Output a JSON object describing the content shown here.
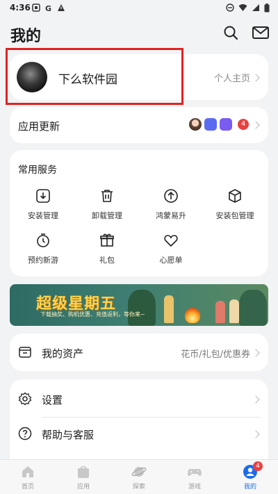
{
  "status_bar": {
    "time": "4:36",
    "icons": [
      "battery-saver-icon",
      "google-g-icon",
      "warning-icon",
      "dnd-icon",
      "wifi-icon",
      "signal-icon",
      "battery-icon"
    ]
  },
  "header": {
    "title": "我的"
  },
  "profile": {
    "name": "下么软件园",
    "home_link": "个人主页"
  },
  "app_update": {
    "label": "应用更新",
    "badge_count": "4"
  },
  "services": {
    "heading": "常用服务",
    "items": [
      {
        "label": "安装管理",
        "icon": "download-box-icon"
      },
      {
        "label": "卸载管理",
        "icon": "trash-icon"
      },
      {
        "label": "鸿蒙易升",
        "icon": "arrow-up-circle-icon"
      },
      {
        "label": "安装包管理",
        "icon": "package-icon"
      },
      {
        "label": "预约新游",
        "icon": "alarm-icon"
      },
      {
        "label": "礼包",
        "icon": "gift-icon"
      },
      {
        "label": "心愿单",
        "icon": "heart-icon"
      }
    ]
  },
  "banner": {
    "title": "超级星期五",
    "subtitle": "下载抽奖、购机优惠、充值返利，等你来~"
  },
  "assets": {
    "label": "我的资产",
    "detail": "花币/礼包/优惠券"
  },
  "settings": {
    "items": [
      {
        "label": "设置"
      },
      {
        "label": "帮助与客服"
      }
    ]
  },
  "tabbar": {
    "tabs": [
      {
        "label": "首页"
      },
      {
        "label": "应用"
      },
      {
        "label": "探索"
      },
      {
        "label": "游戏"
      },
      {
        "label": "我的",
        "badge": "4"
      }
    ]
  },
  "colors": {
    "accent": "#1c6bea",
    "badge": "#e84040",
    "highlight": "#e02222"
  }
}
